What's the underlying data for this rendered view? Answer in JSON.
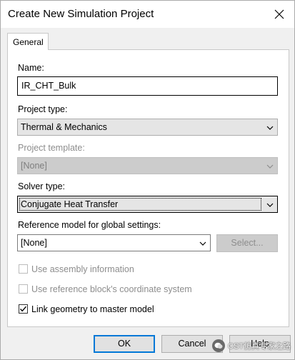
{
  "window": {
    "title": "Create New Simulation Project"
  },
  "tabs": [
    {
      "label": "General"
    }
  ],
  "name": {
    "label": "Name:",
    "value": "IR_CHT_Bulk"
  },
  "project_type": {
    "label": "Project type:",
    "selected": "Thermal & Mechanics"
  },
  "project_template": {
    "label": "Project template:",
    "selected": "[None]"
  },
  "solver_type": {
    "label": "Solver type:",
    "selected": "Conjugate Heat Transfer"
  },
  "reference_model": {
    "label": "Reference model for global settings:",
    "selected": "[None]",
    "select_button": "Select..."
  },
  "options": {
    "assembly": {
      "label": "Use assembly information",
      "checked": false,
      "enabled": false
    },
    "ref_block": {
      "label": "Use reference block's coordinate system",
      "checked": false,
      "enabled": false
    },
    "link_geometry": {
      "label": "Link geometry to master model",
      "checked": true,
      "enabled": true
    }
  },
  "buttons": {
    "ok": "OK",
    "cancel": "Cancel",
    "help": "Help"
  },
  "watermark": {
    "text": "CST仿真专家之路"
  }
}
